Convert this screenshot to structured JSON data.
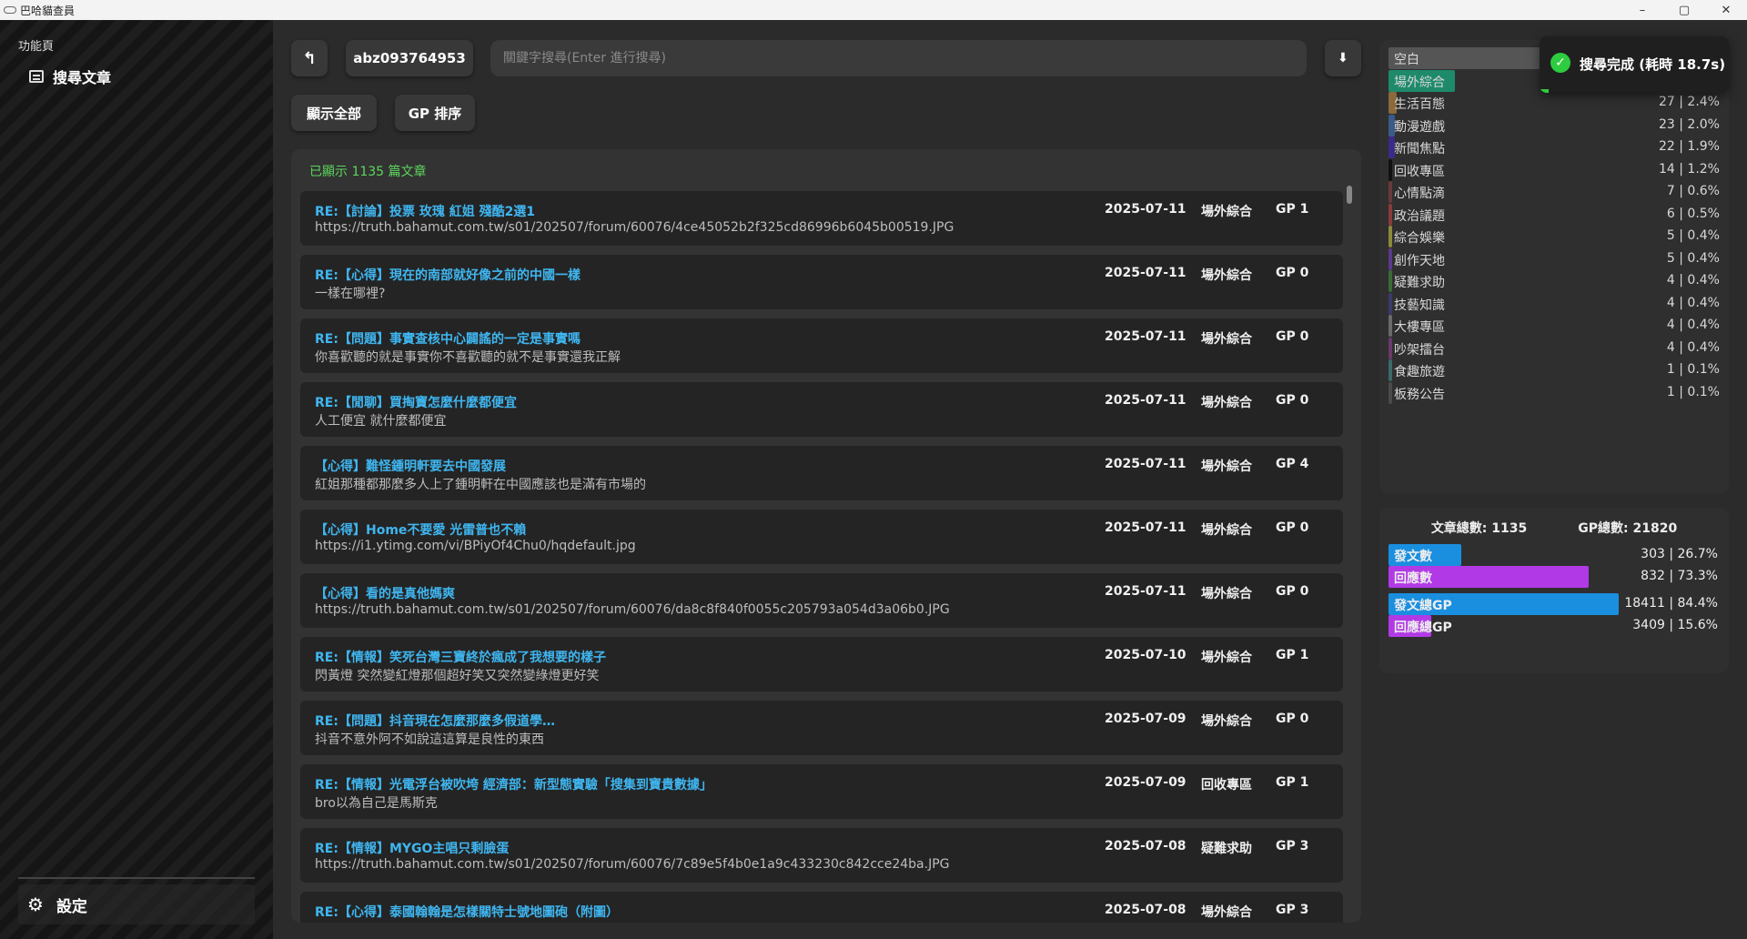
{
  "window": {
    "title": "巴哈貓查員",
    "min": "–",
    "max": "▢",
    "close": "✕"
  },
  "sidebar": {
    "section": "功能頁",
    "nav_label": "搜尋文章",
    "settings_label": "設定"
  },
  "toolbar": {
    "back_icon": "↰",
    "username": "abz093764953",
    "search_placeholder": "關鍵字搜尋(Enter 進行搜尋)",
    "download_icon": "⬇",
    "show_all": "顯示全部",
    "gp_sort": "GP 排序"
  },
  "list": {
    "count_text": "已顯示 1135 篇文章",
    "rows": [
      {
        "title": "RE:【討論】投票 玫瑰 紅姐 殘酷2選1",
        "sub": "https://truth.bahamut.com.tw/s01/202507/forum/60076/4ce45052b2f325cd86996b6045b00519.JPG",
        "date": "2025-07-11",
        "board": "場外綜合",
        "gp": "GP 1"
      },
      {
        "title": "RE:【心得】現在的南部就好像之前的中國一樣",
        "sub": "一樣在哪裡?",
        "date": "2025-07-11",
        "board": "場外綜合",
        "gp": "GP 0"
      },
      {
        "title": "RE:【問題】事實查核中心闢謠的一定是事實嗎",
        "sub": "你喜歡聽的就是事實你不喜歡聽的就不是事實還我正解",
        "date": "2025-07-11",
        "board": "場外綜合",
        "gp": "GP 0"
      },
      {
        "title": "RE:【閒聊】買掏寶怎麼什麼都便宜",
        "sub": "人工便宜 就什麼都便宜",
        "date": "2025-07-11",
        "board": "場外綜合",
        "gp": "GP 0"
      },
      {
        "title": "【心得】難怪鍾明軒要去中國發展",
        "sub": "紅姐那種都那麼多人上了鍾明軒在中國應該也是滿有市場的",
        "date": "2025-07-11",
        "board": "場外綜合",
        "gp": "GP 4"
      },
      {
        "title": "【心得】Home不要愛 光雷普也不賴",
        "sub": "https://i1.ytimg.com/vi/BPiyOf4Chu0/hqdefault.jpg",
        "date": "2025-07-11",
        "board": "場外綜合",
        "gp": "GP 0"
      },
      {
        "title": "【心得】看的是真他媽爽",
        "sub": "https://truth.bahamut.com.tw/s01/202507/forum/60076/da8c8f840f0055c205793a054d3a06b0.JPG",
        "date": "2025-07-11",
        "board": "場外綜合",
        "gp": "GP 0"
      },
      {
        "title": "RE:【情報】笑死台灣三寶終於瘋成了我想要的樣子",
        "sub": "閃黃燈 突然變紅燈那個超好笑又突然變綠燈更好笑",
        "date": "2025-07-10",
        "board": "場外綜合",
        "gp": "GP 1"
      },
      {
        "title": "RE:【問題】抖音現在怎麼那麼多假道學…",
        "sub": "抖音不意外阿不如說這這算是良性的東西",
        "date": "2025-07-09",
        "board": "場外綜合",
        "gp": "GP 0"
      },
      {
        "title": "RE:【情報】光電浮台被吹垮 經濟部：新型態實驗「搜集到寶貴數據」",
        "sub": "bro以為自己是馬斯克",
        "date": "2025-07-09",
        "board": "回收專區",
        "gp": "GP 1"
      },
      {
        "title": "RE:【情報】MYGO主唱只剩臉蛋",
        "sub": "https://truth.bahamut.com.tw/s01/202507/forum/60076/7c89e5f4b0e1a9c433230c842cce24ba.JPG",
        "date": "2025-07-08",
        "board": "疑難求助",
        "gp": "GP 3"
      },
      {
        "title": "RE:【心得】泰國翰翰是怎樣關特士號地圖砲（附圖）",
        "sub": "",
        "date": "2025-07-08",
        "board": "場外綜合",
        "gp": "GP 3"
      }
    ]
  },
  "board_stats": [
    {
      "label": "空白",
      "val": "",
      "pct": "",
      "color": "#555555",
      "fraction": 0.55
    },
    {
      "label": "場外綜合",
      "val": "",
      "pct": "",
      "color": "#1e8a6a",
      "fraction": 0.2
    },
    {
      "label": "生活百態",
      "val": "27 |",
      "pct": "2.4%",
      "color": "#8a6a3a",
      "fraction": 0.024
    },
    {
      "label": "動漫遊戲",
      "val": "23 |",
      "pct": "2.0%",
      "color": "#3a5a8a",
      "fraction": 0.02
    },
    {
      "label": "新聞焦點",
      "val": "22 |",
      "pct": "1.9%",
      "color": "#3a2a8a",
      "fraction": 0.019
    },
    {
      "label": "回收專區",
      "val": "14 |",
      "pct": "1.2%",
      "color": "#111111",
      "fraction": 0.012
    },
    {
      "label": "心情點滴",
      "val": "7 |",
      "pct": "0.6%",
      "color": "#6a3a3a",
      "fraction": 0.006
    },
    {
      "label": "政治議題",
      "val": "6 |",
      "pct": "0.5%",
      "color": "#8a3a3a",
      "fraction": 0.005
    },
    {
      "label": "綜合娛樂",
      "val": "5 |",
      "pct": "0.4%",
      "color": "#8a8a3a",
      "fraction": 0.004
    },
    {
      "label": "創作天地",
      "val": "5 |",
      "pct": "0.4%",
      "color": "#5a3a8a",
      "fraction": 0.004
    },
    {
      "label": "疑難求助",
      "val": "4 |",
      "pct": "0.4%",
      "color": "#3a6a3a",
      "fraction": 0.004
    },
    {
      "label": "技藝知識",
      "val": "4 |",
      "pct": "0.4%",
      "color": "#3a3a6a",
      "fraction": 0.004
    },
    {
      "label": "大樓專區",
      "val": "4 |",
      "pct": "0.4%",
      "color": "#6a6a6a",
      "fraction": 0.004
    },
    {
      "label": "吵架擂台",
      "val": "4 |",
      "pct": "0.4%",
      "color": "#6a3a6a",
      "fraction": 0.004
    },
    {
      "label": "食趣旅遊",
      "val": "1 |",
      "pct": "0.1%",
      "color": "#3a6a6a",
      "fraction": 0.001
    },
    {
      "label": "板務公告",
      "val": "1 |",
      "pct": "0.1%",
      "color": "#4a4a4a",
      "fraction": 0.001
    }
  ],
  "summary": {
    "total_posts": "文章總數: 1135",
    "total_gp": "GP總數: 21820",
    "rows": [
      {
        "label": "發文數",
        "val": "303 | 26.7%",
        "color": "#1a8fe0",
        "fraction": 0.267
      },
      {
        "label": "回應數",
        "val": "832 | 73.3%",
        "color": "#b13ae6",
        "fraction": 0.733
      },
      {
        "label": "發文總GP",
        "val": "18411 | 84.4%",
        "color": "#1a8fe0",
        "fraction": 0.844
      },
      {
        "label": "回應總GP",
        "val": "3409 | 15.6%",
        "color": "#b13ae6",
        "fraction": 0.156
      }
    ]
  },
  "toast": {
    "icon": "✓",
    "message": "搜尋完成 (耗時 18.7s)",
    "progress": 0.05
  }
}
